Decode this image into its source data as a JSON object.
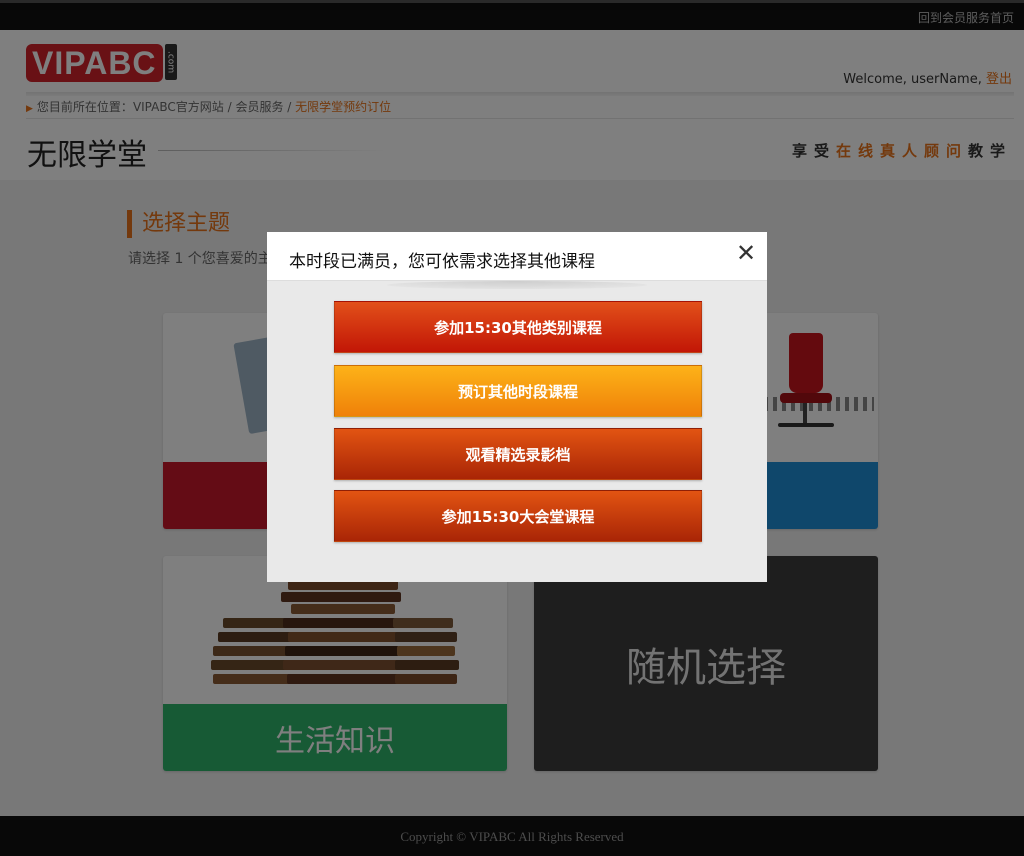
{
  "topbar": {
    "member_home": "回到会员服务首页"
  },
  "header": {
    "logo_text": "VIPABC",
    "logo_suffix": ".com",
    "welcome": "Welcome, userName,",
    "logout": "登出",
    "breadcrumb": {
      "prefix": "您目前所在位置：",
      "item1": "VIPABC官方网站",
      "sep": " / ",
      "item2": "会员服务",
      "current": "无限学堂预约订位"
    },
    "page_title": "无限学堂",
    "slogan": {
      "part1": "享受",
      "highlight": "在线真人顾问",
      "part2": "教学"
    }
  },
  "content": {
    "section_title": "选择主题",
    "section_sub": "请选择 1 个您喜爱的主题",
    "cards": [
      {
        "label": "",
        "color": "#c8182a"
      },
      {
        "label": "",
        "color": "#1e8fd6"
      },
      {
        "label": "生活知识",
        "color": "#2fb46a"
      },
      {
        "label": "随机选择",
        "color": "#3c3c3c"
      }
    ]
  },
  "footer": {
    "copyright": "Copyright © VIPABC All Rights Reserved"
  },
  "dialog": {
    "title": "本时段已满员，您可依需求选择其他课程",
    "close_symbol": "✕",
    "options": [
      {
        "label": "参加15:30其他类别课程"
      },
      {
        "label": "预订其他时段课程"
      },
      {
        "label": "观看精选录影档"
      },
      {
        "label": "参加15:30大会堂课程"
      }
    ]
  },
  "colors": {
    "accent": "#e8731a",
    "primary_red": "#c21606",
    "orange": "#f29a0f"
  }
}
